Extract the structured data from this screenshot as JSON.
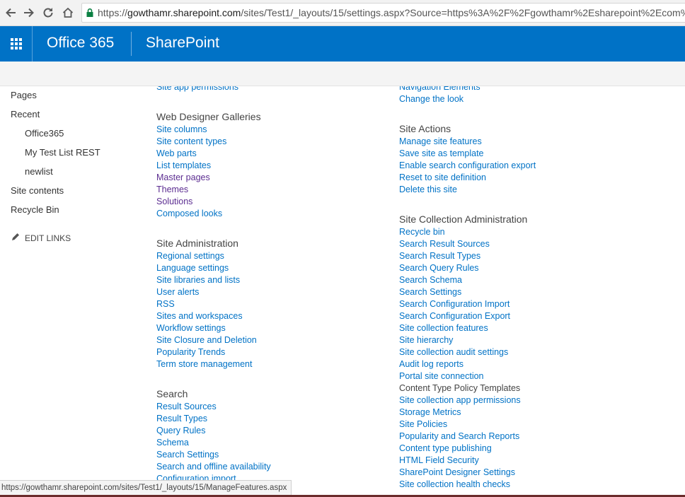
{
  "browser": {
    "url_scheme": "https://",
    "url_host": "gowthamr.sharepoint.com",
    "url_path": "/sites/Test1/_layouts/15/settings.aspx?Source=https%3A%2F%2Fgowthamr%2Esharepoint%2Ecom%",
    "nav_icons": [
      "back-arrow-icon",
      "forward-arrow-icon",
      "reload-icon",
      "home-icon",
      "lock-icon"
    ]
  },
  "suite": {
    "brand": "Office 365",
    "product": "SharePoint",
    "color": "#0072c6"
  },
  "leftnav": {
    "items": [
      {
        "label": "Pages",
        "level": 0
      },
      {
        "label": "Recent",
        "level": 0
      },
      {
        "label": "Office365",
        "level": 1
      },
      {
        "label": "My Test List REST",
        "level": 1
      },
      {
        "label": "newlist",
        "level": 1
      },
      {
        "label": "Site contents",
        "level": 0
      },
      {
        "label": "Recycle Bin",
        "level": 0
      }
    ],
    "edit_links": "EDIT LINKS"
  },
  "col1": {
    "top_link": "Site app permissions",
    "web_designer": {
      "title": "Web Designer Galleries",
      "links": [
        "Site columns",
        "Site content types",
        "Web parts",
        "List templates",
        "Master pages",
        "Themes",
        "Solutions",
        "Composed looks"
      ]
    },
    "site_admin": {
      "title": "Site Administration",
      "links": [
        "Regional settings",
        "Language settings",
        "Site libraries and lists",
        "User alerts",
        "RSS",
        "Sites and workspaces",
        "Workflow settings",
        "Site Closure and Deletion",
        "Popularity Trends",
        "Term store management"
      ]
    },
    "search": {
      "title": "Search",
      "links": [
        "Result Sources",
        "Result Types",
        "Query Rules",
        "Schema",
        "Search Settings",
        "Search and offline availability",
        "Configuration import"
      ]
    }
  },
  "col2": {
    "top_links": [
      "Navigation Elements",
      "Change the look"
    ],
    "site_actions": {
      "title": "Site Actions",
      "links": [
        "Manage site features",
        "Save site as template",
        "Enable search configuration export",
        "Reset to site definition",
        "Delete this site"
      ]
    },
    "site_collection": {
      "title": "Site Collection Administration",
      "links": [
        "Recycle bin",
        "Search Result Sources",
        "Search Result Types",
        "Search Query Rules",
        "Search Schema",
        "Search Settings",
        "Search Configuration Import",
        "Search Configuration Export",
        "Site collection features",
        "Site hierarchy",
        "Site collection audit settings",
        "Audit log reports",
        "Portal site connection",
        "Content Type Policy Templates",
        "Site collection app permissions",
        "Storage Metrics",
        "Site Policies",
        "Popularity and Search Reports",
        "Content type publishing",
        "HTML Field Security",
        "SharePoint Designer Settings",
        "Site collection health checks"
      ]
    }
  },
  "statusbar": {
    "text": "https://gowthamr.sharepoint.com/sites/Test1/_layouts/15/ManageFeatures.aspx"
  }
}
